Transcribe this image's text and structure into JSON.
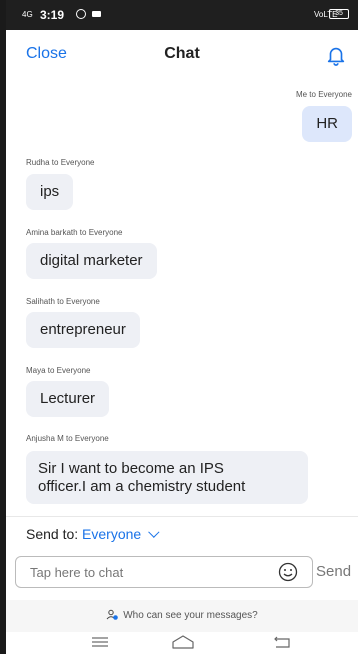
{
  "status_bar": {
    "signal": "4G",
    "time": "3:19",
    "network": "VoLTE",
    "battery": "35"
  },
  "header": {
    "close_label": "Close",
    "title": "Chat",
    "bell_icon": "bell-icon"
  },
  "messages": [
    {
      "sender": "Me to Everyone",
      "text": "HR",
      "mine": true
    },
    {
      "sender": "Rudha to Everyone",
      "text": "ips",
      "mine": false
    },
    {
      "sender": "Amina barkath to Everyone",
      "text": "digital marketer",
      "mine": false
    },
    {
      "sender": "Salihath to Everyone",
      "text": "entrepreneur",
      "mine": false
    },
    {
      "sender": "Maya to Everyone",
      "text": "Lecturer",
      "mine": false
    },
    {
      "sender": "Anjusha M to Everyone",
      "text_line1": "Sir I want to become an IPS",
      "text_line2": "officer.I am a chemistry student",
      "mine": false
    }
  ],
  "compose": {
    "send_to_label": "Send to:",
    "send_to_target": "Everyone",
    "input_placeholder": "Tap here to chat",
    "send_label": "Send"
  },
  "privacy_text": "Who can see your messages?",
  "colors": {
    "accent": "#1a73e8",
    "bubble": "#eef0f5",
    "my_bubble": "#dde7fb"
  }
}
